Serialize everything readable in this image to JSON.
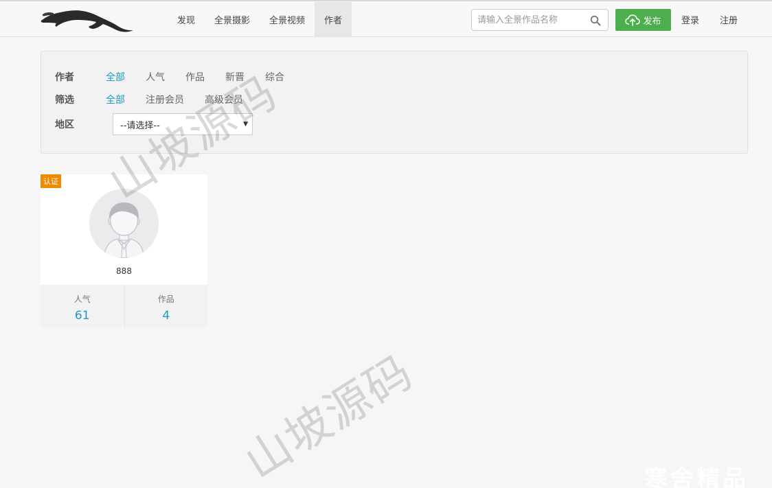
{
  "header": {
    "nav": [
      {
        "label": "发现"
      },
      {
        "label": "全景摄影"
      },
      {
        "label": "全景视频"
      },
      {
        "label": "作者"
      }
    ],
    "active_nav": "作者",
    "search": {
      "placeholder": "请输入全景作品名称"
    },
    "publish_label": "发布",
    "login_label": "登录",
    "register_label": "注册"
  },
  "filters": {
    "author": {
      "label": "作者",
      "options": [
        "全部",
        "人气",
        "作品",
        "新晋",
        "综合"
      ],
      "active": "全部"
    },
    "screen": {
      "label": "筛选",
      "options": [
        "全部",
        "注册会员",
        "高级会员"
      ],
      "active": "全部"
    },
    "region": {
      "label": "地区",
      "selected": "--请选择--"
    }
  },
  "authors": [
    {
      "badge": "认证",
      "name": "888",
      "popularity_label": "人气",
      "popularity": "61",
      "works_label": "作品",
      "works": "4"
    }
  ],
  "watermarks": [
    "山坡源码",
    "山坡源码",
    "寒舍精品"
  ],
  "colors": {
    "accent": "#1b9bbf",
    "publish_button": "#4cae4c",
    "badge": "#f08a00"
  },
  "icons": {
    "logo": "panther-logo",
    "search": "search-icon",
    "publish": "cloud-upload-icon",
    "select": "caret-down-icon"
  }
}
